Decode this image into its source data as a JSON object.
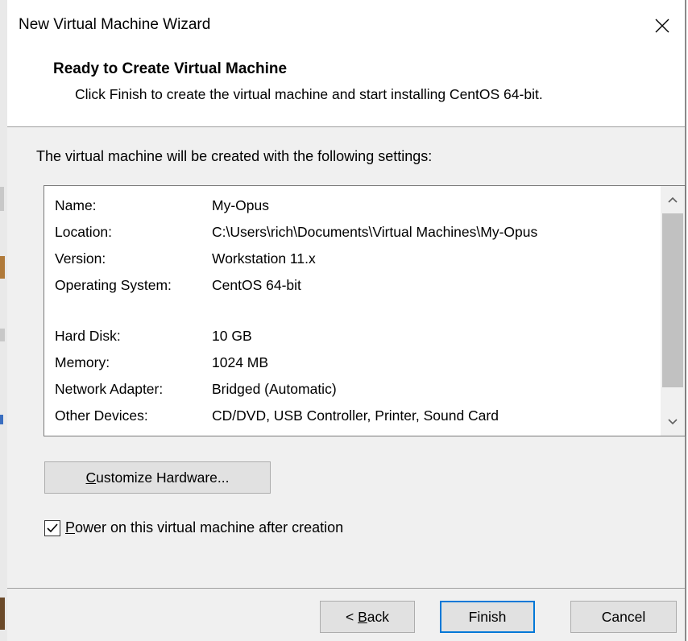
{
  "window": {
    "title": "New Virtual Machine Wizard",
    "close_icon": "close-icon"
  },
  "header": {
    "title": "Ready to Create Virtual Machine",
    "subtitle": "Click Finish to create the virtual machine and start installing CentOS 64-bit."
  },
  "intro": "The virtual machine will be created with the following settings:",
  "settings": [
    {
      "key": "Name:",
      "value": "My-Opus"
    },
    {
      "key": "Location:",
      "value": "C:\\Users\\rich\\Documents\\Virtual Machines\\My-Opus"
    },
    {
      "key": "Version:",
      "value": "Workstation 11.x"
    },
    {
      "key": "Operating System:",
      "value": "CentOS 64-bit"
    },
    {
      "key": "Hard Disk:",
      "value": "10 GB"
    },
    {
      "key": "Memory:",
      "value": "1024 MB"
    },
    {
      "key": "Network Adapter:",
      "value": "Bridged (Automatic)"
    },
    {
      "key": "Other Devices:",
      "value": "CD/DVD, USB Controller, Printer, Sound Card"
    }
  ],
  "buttons": {
    "customize": {
      "mnemonic": "C",
      "rest": "ustomize Hardware..."
    },
    "back": {
      "prefix": "< ",
      "mnemonic": "B",
      "rest": "ack"
    },
    "finish": "Finish",
    "cancel": "Cancel"
  },
  "power_on": {
    "checked": true,
    "mnemonic": "P",
    "rest": "ower on this virtual machine after creation"
  },
  "colors": {
    "dialog_bg": "#f0f0f0",
    "default_button_border": "#0078d7"
  }
}
